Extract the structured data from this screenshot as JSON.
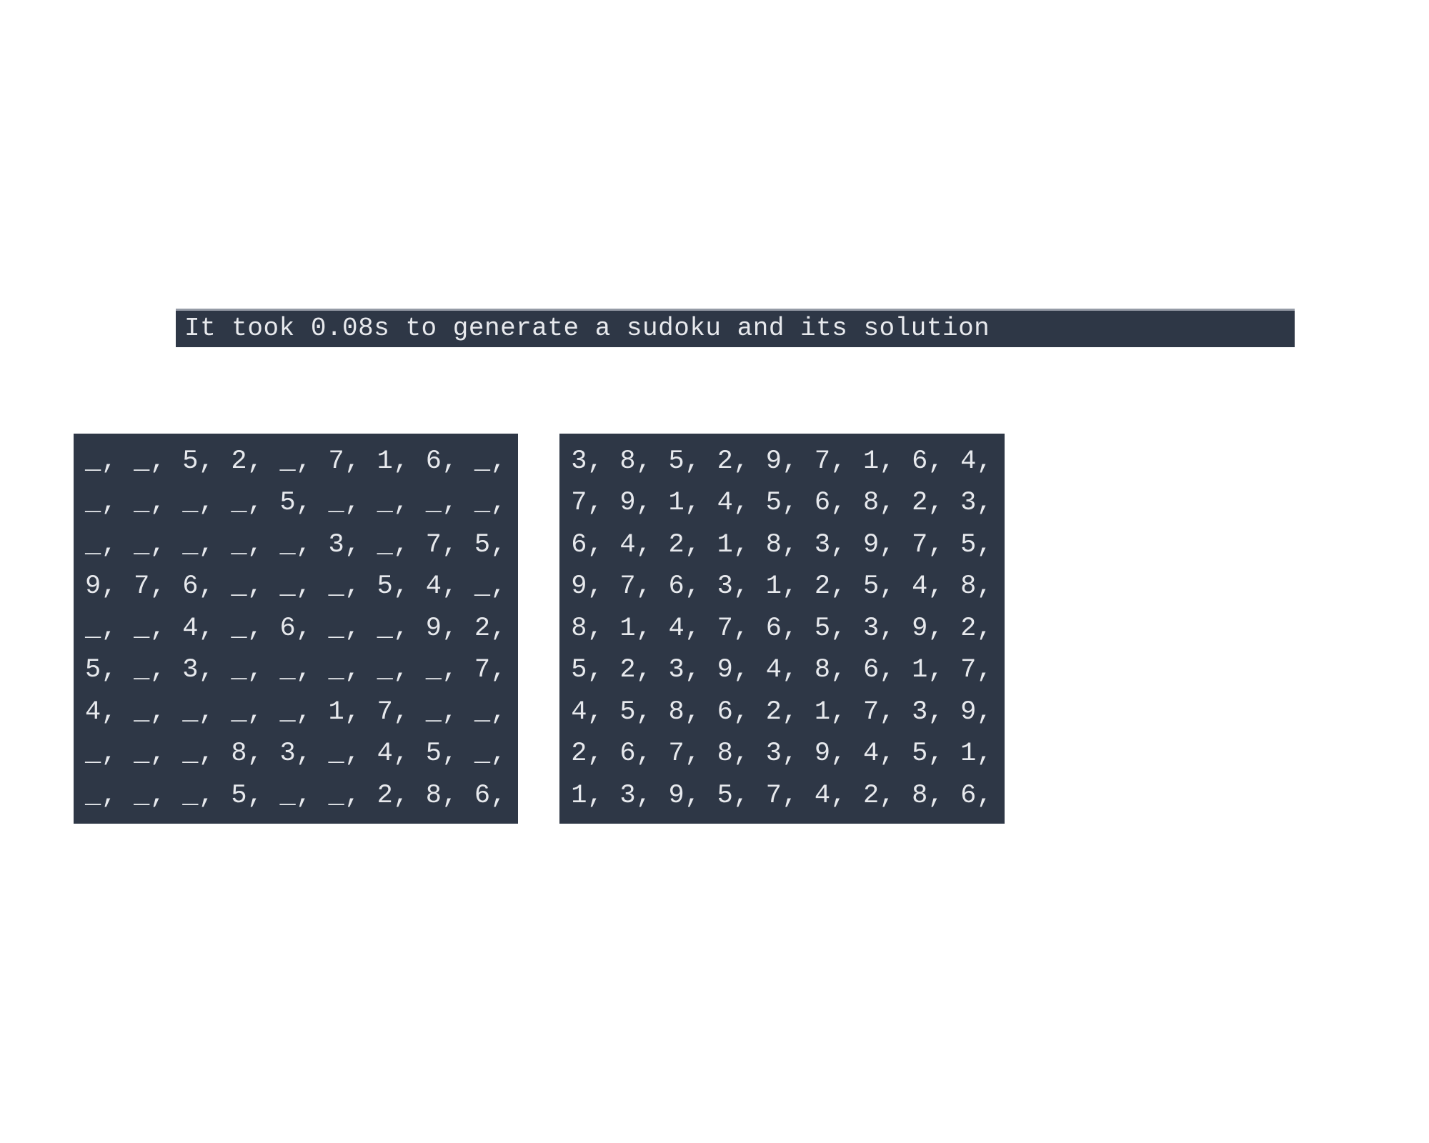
{
  "banner": {
    "text": "It took 0.08s to generate a sudoku and its solution"
  },
  "puzzle": {
    "rows": [
      [
        "_",
        "_",
        "5",
        "2",
        "_",
        "7",
        "1",
        "6",
        "_"
      ],
      [
        "_",
        "_",
        "_",
        "_",
        "5",
        "_",
        "_",
        "_",
        "_"
      ],
      [
        "_",
        "_",
        "_",
        "_",
        "_",
        "3",
        "_",
        "7",
        "5"
      ],
      [
        "9",
        "7",
        "6",
        "_",
        "_",
        "_",
        "5",
        "4",
        "_"
      ],
      [
        "_",
        "_",
        "4",
        "_",
        "6",
        "_",
        "_",
        "9",
        "2"
      ],
      [
        "5",
        "_",
        "3",
        "_",
        "_",
        "_",
        "_",
        "_",
        "7"
      ],
      [
        "4",
        "_",
        "_",
        "_",
        "_",
        "1",
        "7",
        "_",
        "_"
      ],
      [
        "_",
        "_",
        "_",
        "8",
        "3",
        "_",
        "4",
        "5",
        "_"
      ],
      [
        "_",
        "_",
        "_",
        "5",
        "_",
        "_",
        "2",
        "8",
        "6"
      ]
    ]
  },
  "solution": {
    "rows": [
      [
        "3",
        "8",
        "5",
        "2",
        "9",
        "7",
        "1",
        "6",
        "4"
      ],
      [
        "7",
        "9",
        "1",
        "4",
        "5",
        "6",
        "8",
        "2",
        "3"
      ],
      [
        "6",
        "4",
        "2",
        "1",
        "8",
        "3",
        "9",
        "7",
        "5"
      ],
      [
        "9",
        "7",
        "6",
        "3",
        "1",
        "2",
        "5",
        "4",
        "8"
      ],
      [
        "8",
        "1",
        "4",
        "7",
        "6",
        "5",
        "3",
        "9",
        "2"
      ],
      [
        "5",
        "2",
        "3",
        "9",
        "4",
        "8",
        "6",
        "1",
        "7"
      ],
      [
        "4",
        "5",
        "8",
        "6",
        "2",
        "1",
        "7",
        "3",
        "9"
      ],
      [
        "2",
        "6",
        "7",
        "8",
        "3",
        "9",
        "4",
        "5",
        "1"
      ],
      [
        "1",
        "3",
        "9",
        "5",
        "7",
        "4",
        "2",
        "8",
        "6"
      ]
    ]
  }
}
